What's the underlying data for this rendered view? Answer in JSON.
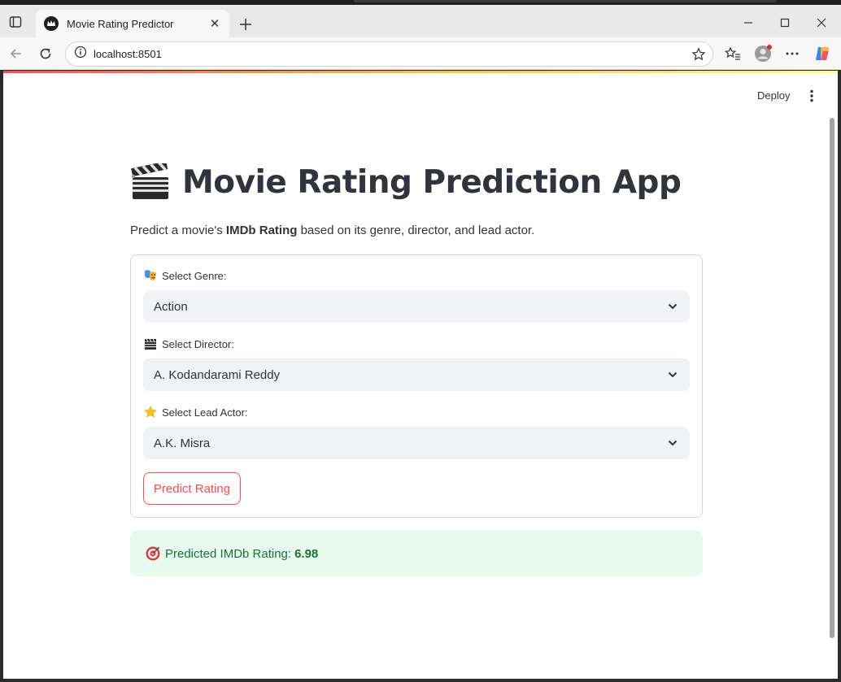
{
  "browser": {
    "tab_title": "Movie Rating Predictor",
    "url": "localhost:8501"
  },
  "header": {
    "deploy_label": "Deploy"
  },
  "main": {
    "title": "Movie Rating Prediction App",
    "subtitle_prefix": "Predict a movie's ",
    "subtitle_bold": "IMDb Rating",
    "subtitle_suffix": " based on its genre, director, and lead actor."
  },
  "form": {
    "genre_label": "Select Genre:",
    "genre_value": "Action",
    "director_label": "Select Director:",
    "director_value": "A. Kodandarami Reddy",
    "actor_label": "Select Lead Actor:",
    "actor_value": "A.K. Misra",
    "predict_label": "Predict Rating"
  },
  "result": {
    "label": "Predicted IMDb Rating:",
    "value": "6.98"
  },
  "colors": {
    "primary": "#ff4b4b",
    "success_bg": "#e8f9ee",
    "success_text": "#177233",
    "text": "#31333f"
  },
  "icons": {
    "genre": "theater-masks-icon",
    "director": "clapperboard-icon",
    "actor": "star-icon",
    "result": "target-icon",
    "title": "clapperboard-icon"
  }
}
